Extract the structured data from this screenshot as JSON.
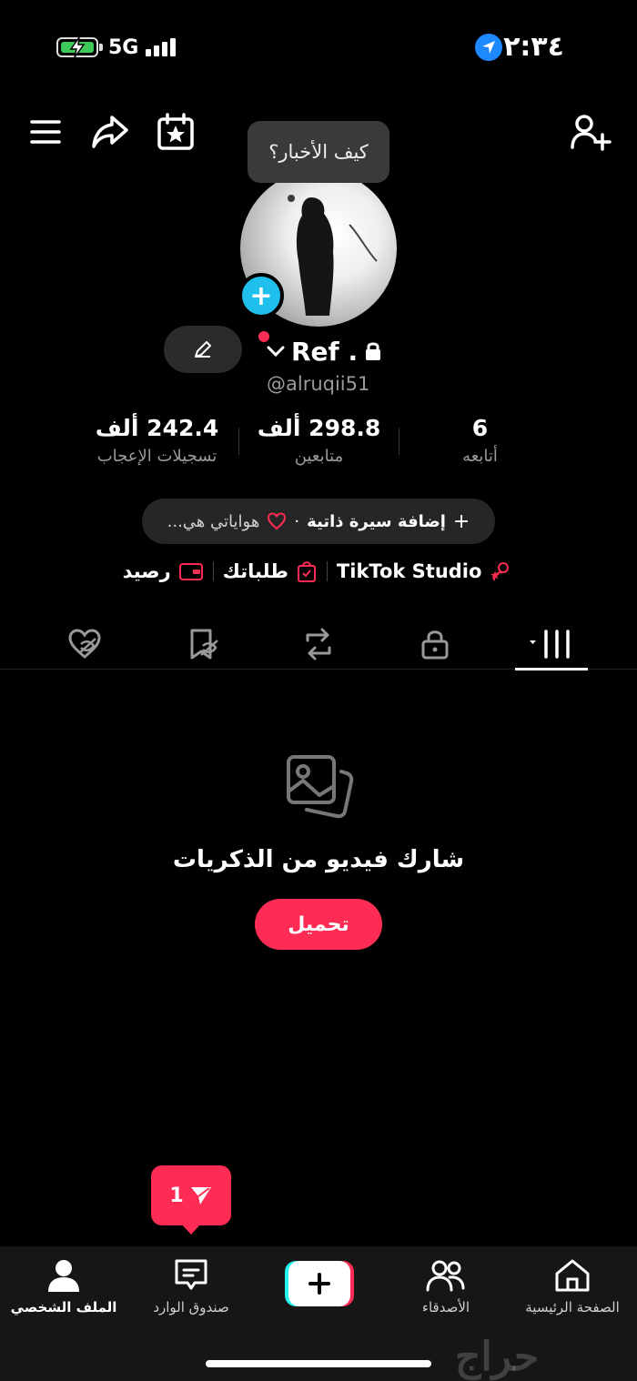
{
  "status_bar": {
    "time": "٢:٣٤",
    "network": "5G"
  },
  "bubble": {
    "text": "كيف الأخبار؟"
  },
  "profile": {
    "name": "Ref .",
    "handle": "@alruqii51"
  },
  "stats": [
    {
      "value": "242.4 ألف",
      "label": "تسجيلات الإعجاب"
    },
    {
      "value": "298.8 ألف",
      "label": "متابعين"
    },
    {
      "value": "6",
      "label": "أتابعه"
    }
  ],
  "bio": {
    "add_label": "إضافة سيرة ذاتية",
    "separator": "·",
    "hobbies": "هواياتي هي..."
  },
  "links": {
    "studio": "TikTok Studio",
    "orders": "طلباتك",
    "balance": "رصيد"
  },
  "empty_state": {
    "title": "شارك فيديو من الذكريات",
    "button": "تحميل"
  },
  "inbox_popup": {
    "count": "1"
  },
  "bottom_nav": {
    "profile": "الملف الشخصي",
    "inbox": "صندوق الوارد",
    "friends": "الأصدقاء",
    "home": "الصفحة الرئيسية"
  },
  "watermark": "حراج",
  "colors": {
    "accent": "#fe2c55",
    "avatar_add": "#20c0ee",
    "location": "#1e88ff"
  }
}
